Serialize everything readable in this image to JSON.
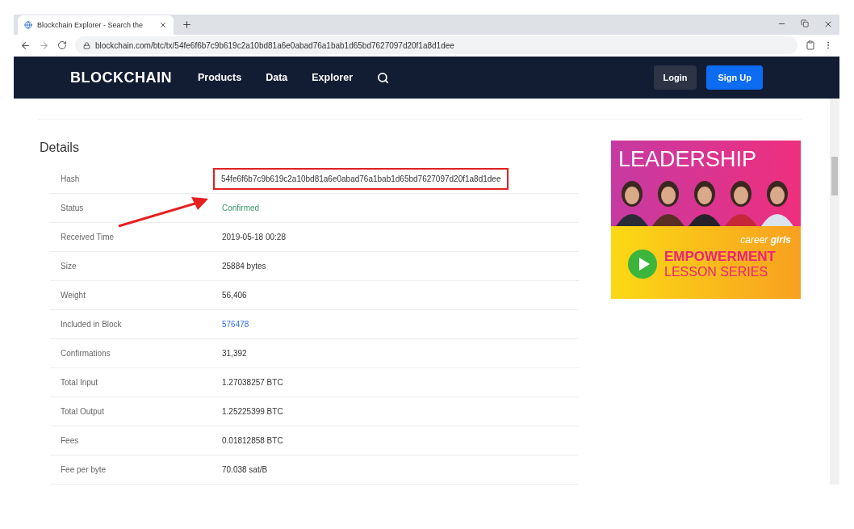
{
  "browser": {
    "tab_title": "Blockchain Explorer - Search the",
    "url": "blockchain.com/btc/tx/54fe6f6b7c9b619c2a10bd81a6e0abad76a1bab1d65bd7627097d20f1a8d1dee"
  },
  "nav": {
    "logo": "BLOCKCHAIN",
    "links": [
      "Products",
      "Data",
      "Explorer"
    ],
    "login": "Login",
    "signup": "Sign Up"
  },
  "details": {
    "title": "Details",
    "rows": [
      {
        "label": "Hash",
        "value": "54fe6f6b7c9b619c2a10bd81a6e0abad76a1bab1d65bd7627097d20f1a8d1dee",
        "kind": "text",
        "highlighted": true
      },
      {
        "label": "Status",
        "value": "Confirmed",
        "kind": "status",
        "highlighted": false
      },
      {
        "label": "Received Time",
        "value": "2019-05-18 00:28",
        "kind": "text",
        "highlighted": false
      },
      {
        "label": "Size",
        "value": "25884 bytes",
        "kind": "text",
        "highlighted": false
      },
      {
        "label": "Weight",
        "value": "56,406",
        "kind": "text",
        "highlighted": false
      },
      {
        "label": "Included in Block",
        "value": "576478",
        "kind": "link",
        "highlighted": false
      },
      {
        "label": "Confirmations",
        "value": "31,392",
        "kind": "text",
        "highlighted": false
      },
      {
        "label": "Total Input",
        "value": "1.27038257 BTC",
        "kind": "text",
        "highlighted": false
      },
      {
        "label": "Total Output",
        "value": "1.25225399 BTC",
        "kind": "text",
        "highlighted": false
      },
      {
        "label": "Fees",
        "value": "0.01812858 BTC",
        "kind": "text",
        "highlighted": false
      },
      {
        "label": "Fee per byte",
        "value": "70.038 sat/B",
        "kind": "text",
        "highlighted": false
      }
    ]
  },
  "ad": {
    "headline": "LEADERSHIP",
    "brand_1": "career",
    "brand_2": "girls",
    "line_1": "EMPOWERMENT",
    "line_2": "LESSON SERIES"
  }
}
